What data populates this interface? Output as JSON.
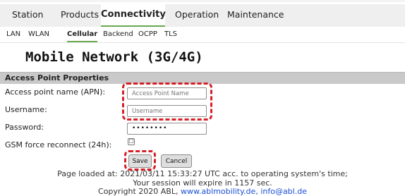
{
  "main_nav": {
    "tabs": [
      {
        "label": "Station"
      },
      {
        "label": "Products"
      },
      {
        "label": "Connectivity"
      },
      {
        "label": "Operation"
      },
      {
        "label": "Maintenance"
      }
    ],
    "active": "Connectivity"
  },
  "sub_nav": {
    "tabs": [
      {
        "label": "LAN"
      },
      {
        "label": "WLAN"
      },
      {
        "label": "Cellular"
      },
      {
        "label": "Backend"
      },
      {
        "label": "OCPP"
      },
      {
        "label": "TLS"
      }
    ],
    "active": "Cellular"
  },
  "page": {
    "title": "Mobile Network (3G/4G)",
    "section_title": "Access Point Properties"
  },
  "form": {
    "apn_label": "Access point name (APN):",
    "apn_placeholder": "Access Point Name",
    "username_label": "Username:",
    "username_placeholder": "Username",
    "password_label": "Password:",
    "password_value": "••••••••",
    "gsm_label": "GSM force reconnect (24h):",
    "gsm_checked": false,
    "checkbox_glyph": "☐",
    "save_label": "Save",
    "cancel_label": "Cancel"
  },
  "footer": {
    "loaded": "Page loaded at: 2021/03/11 15:33:27 UTC acc. to operating system's time;",
    "session": "Your session will expire in 1157 sec.",
    "copyright": "Copyright 2020 ABL,",
    "website": "www.ablmobility.de,",
    "email": "info@abl.de"
  },
  "colors": {
    "highlight": "#d62028",
    "active_underline": "#6aa84f",
    "section_bar": "#c9c9c9",
    "link": "#1a4fd6"
  }
}
